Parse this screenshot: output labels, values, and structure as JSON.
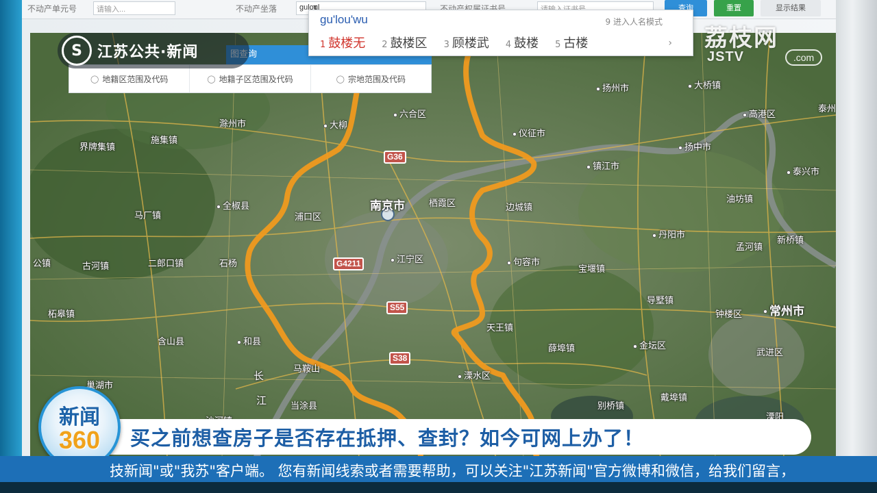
{
  "toolbar": {
    "label1": "不动产单元号",
    "field1_placeholder": "请输入...",
    "label2": "不动产坐落",
    "field2_value": "guloul",
    "label3": "不动产权属证书号",
    "field3_placeholder": "请输入证书号",
    "query_button": "查询",
    "reset_button": "重置",
    "display_button": "显示结果"
  },
  "ime": {
    "pinyin": "gu'lou'wu",
    "hint": "9 进入人名模式",
    "candidates": [
      {
        "num": "1",
        "text": "鼓楼无"
      },
      {
        "num": "2",
        "text": "鼓楼区"
      },
      {
        "num": "3",
        "text": "顾楼武"
      },
      {
        "num": "4",
        "text": "鼓楼"
      },
      {
        "num": "5",
        "text": "古楼"
      }
    ],
    "more": "›"
  },
  "map_panel": {
    "tab_label": "图查询",
    "queries": [
      "地籍区范围及代码",
      "地籍子区范围及代码",
      "宗地范围及代码"
    ]
  },
  "map": {
    "places": [
      "滁州市",
      "大柳",
      "六合区",
      "仪征市",
      "扬州市",
      "大桥镇",
      "高港区",
      "泰州",
      "扬中市",
      "镇江市",
      "泰兴市",
      "油坊镇",
      "丹阳市",
      "孟河镇",
      "新桥镇",
      "句容市",
      "宝堰镇",
      "导墅镇",
      "钟楼区",
      "常州市",
      "天王镇",
      "薛埠镇",
      "金坛区",
      "武进区",
      "溧水区",
      "当涂县",
      "马鞍山",
      "和县",
      "含山县",
      "巢湖市",
      "柘皋镇",
      "古河镇",
      "二郎口镇",
      "石杨",
      "全椒县",
      "马厂镇",
      "施集镇",
      "界牌集镇",
      "江宁区",
      "浦口区",
      "栖霞区",
      "边城镇",
      "别桥镇",
      "戴埠镇",
      "溧阳",
      "沙河镇",
      "公镇"
    ],
    "city_main": "南京市",
    "shields": [
      "G36",
      "G4211",
      "S55",
      "S38"
    ],
    "river_labels": [
      "长",
      "江"
    ]
  },
  "broadcast": {
    "channel_logo": "江苏公共·新闻",
    "channel_logo_symbol": "S",
    "corner_logo_cn": "荔枝网",
    "corner_logo_en": "JSTV",
    "corner_logo_pill": ".com",
    "program_top": "新闻",
    "program_bottom": "360",
    "headline": "买之前想查房子是否存在抵押、查封？如今可网上办了！",
    "ticker": "技新闻\"或\"我苏\"客户端。    您有新闻线索或者需要帮助，可以关注\"江苏新闻\"官方微博和微信，给我们留言，"
  },
  "colors": {
    "boundary": "#f09a1f",
    "headline_text": "#1d5ea5",
    "ticker_bg": "#1d6fb7",
    "ime_highlight": "#d0342c"
  }
}
